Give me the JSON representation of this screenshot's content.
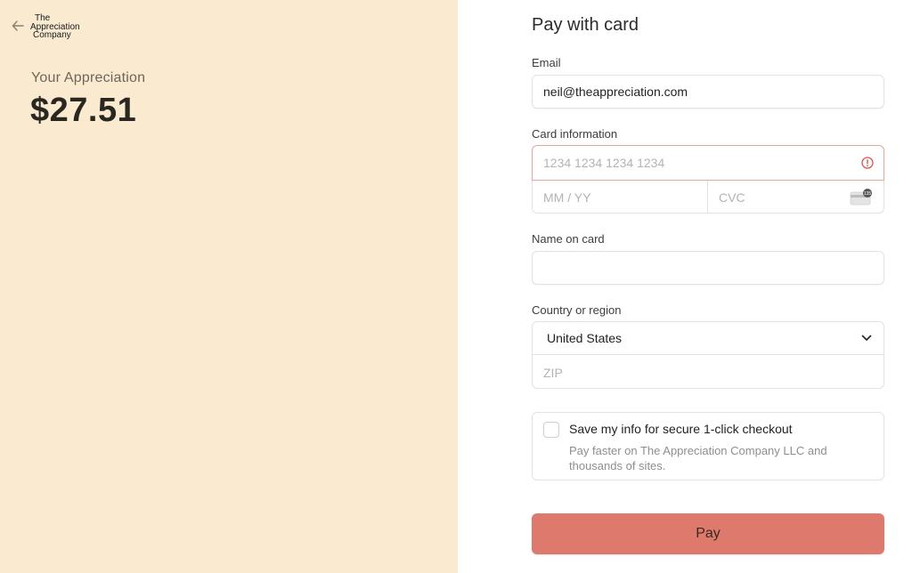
{
  "brand": {
    "logo_text": "The Appreciation Company",
    "bg_color": "#f9ead0"
  },
  "summary": {
    "label": "Your Appreciation",
    "amount": "$27.51"
  },
  "form": {
    "title": "Pay with card",
    "email": {
      "label": "Email",
      "value": "neil@theappreciation.com"
    },
    "card": {
      "label": "Card information",
      "number_placeholder": "1234 1234 1234 1234",
      "expiry_placeholder": "MM / YY",
      "cvc_placeholder": "CVC",
      "cvc_badge": "135",
      "error_color": "#e8a79b"
    },
    "name": {
      "label": "Name on card",
      "value": ""
    },
    "country": {
      "label": "Country or region",
      "selected": "United States",
      "zip_placeholder": "ZIP"
    },
    "save": {
      "title": "Save my info for secure 1-click checkout",
      "description": "Pay faster on The Appreciation Company LLC and thousands of sites.",
      "checked": false
    },
    "pay_button": {
      "label": "Pay",
      "color": "#de7a6d"
    }
  }
}
